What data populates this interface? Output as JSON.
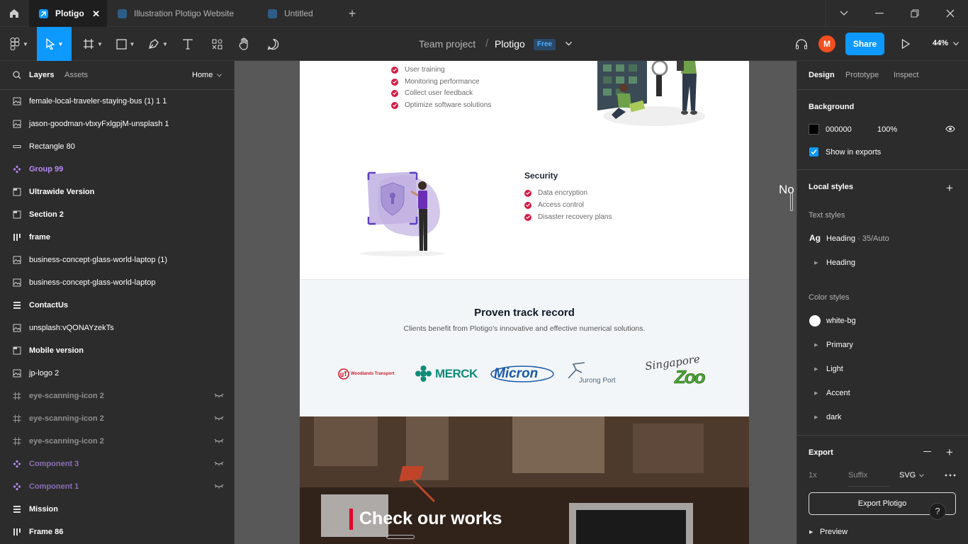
{
  "tabs": [
    {
      "label": "Plotigo",
      "active": true
    },
    {
      "label": "Illustration Plotigo Website"
    },
    {
      "label": "Untitled"
    }
  ],
  "toolbar": {
    "project": "Team project",
    "separator": "/",
    "file": "Plotigo",
    "plan_badge": "Free",
    "avatar_initial": "M",
    "share_label": "Share",
    "zoom": "44%"
  },
  "left_panel": {
    "tabs": [
      "Layers",
      "Assets"
    ],
    "page": "Home",
    "layers": [
      {
        "name": "female-local-traveler-staying-bus (1) 1 1",
        "icon": "image-icon"
      },
      {
        "name": "jason-goodman-vbxyFxlgpjM-unsplash 1",
        "icon": "image-icon"
      },
      {
        "name": "Rectangle 80",
        "icon": "rectangle-icon"
      },
      {
        "name": "Group 99",
        "icon": "component-icon"
      },
      {
        "name": "Ultrawide Version",
        "icon": "section-icon"
      },
      {
        "name": "Section 2",
        "icon": "section-icon"
      },
      {
        "name": "frame",
        "icon": "column-layout-icon"
      },
      {
        "name": "business-concept-glass-world-laptop (1)",
        "icon": "image-icon"
      },
      {
        "name": "business-concept-glass-world-laptop",
        "icon": "image-icon"
      },
      {
        "name": "ContactUs",
        "icon": "row-layout-icon"
      },
      {
        "name": "unsplash:vQONAYzekTs",
        "icon": "image-icon"
      },
      {
        "name": "Mobile version",
        "icon": "section-icon"
      },
      {
        "name": "jp-logo 2",
        "icon": "image-icon"
      },
      {
        "name": "eye-scanning-icon 2",
        "icon": "frame-icon"
      },
      {
        "name": "eye-scanning-icon 2",
        "icon": "frame-icon"
      },
      {
        "name": "eye-scanning-icon 2",
        "icon": "frame-icon"
      },
      {
        "name": "Component 3",
        "icon": "component-icon"
      },
      {
        "name": "Component 1",
        "icon": "component-icon"
      },
      {
        "name": "Mission",
        "icon": "row-layout-icon"
      },
      {
        "name": "Frame 86",
        "icon": "column-layout-icon"
      }
    ]
  },
  "canvas": {
    "list_top": [
      "User training",
      "Monitoring performance",
      "Collect user feedback",
      "Optimize software solutions"
    ],
    "security_title": "Security",
    "security_items": [
      "Data encryption",
      "Access control",
      "Disaster recovery plans"
    ],
    "track_title": "Proven track record",
    "track_subtitle": "Clients benefit from Plotigo's innovative and effective numerical solutions.",
    "logos": {
      "woodlands": "Woodlands Transport",
      "merck": "MERCK",
      "micron": "Micron",
      "jurong": "Jurong Port",
      "zoo_top": "Singapore",
      "zoo_bottom": "Zoo"
    },
    "works_title": "Check our works",
    "side_fragment": "No"
  },
  "right_panel": {
    "tabs": [
      "Design",
      "Prototype",
      "Inspect"
    ],
    "background_title": "Background",
    "bg_hex": "000000",
    "bg_opacity": "100%",
    "show_in_exports": "Show in exports",
    "local_styles": "Local styles",
    "text_styles": "Text styles",
    "text_style_name": "Heading",
    "text_style_spec": "· 35/Auto",
    "text_group": "Heading",
    "color_styles": "Color styles",
    "color_items": [
      "white-bg",
      "Primary",
      "Light",
      "Accent",
      "dark"
    ],
    "export_title": "Export",
    "export_scale": "1x",
    "export_suffix": "Suffix",
    "export_format": "SVG",
    "export_button": "Export Plotigo",
    "preview": "Preview"
  },
  "colors": {
    "accent": "#0d99ff",
    "share": "#0d99ff",
    "avatar": "#f24e1e",
    "check": "#d41b45",
    "component": "#b68cf5"
  }
}
